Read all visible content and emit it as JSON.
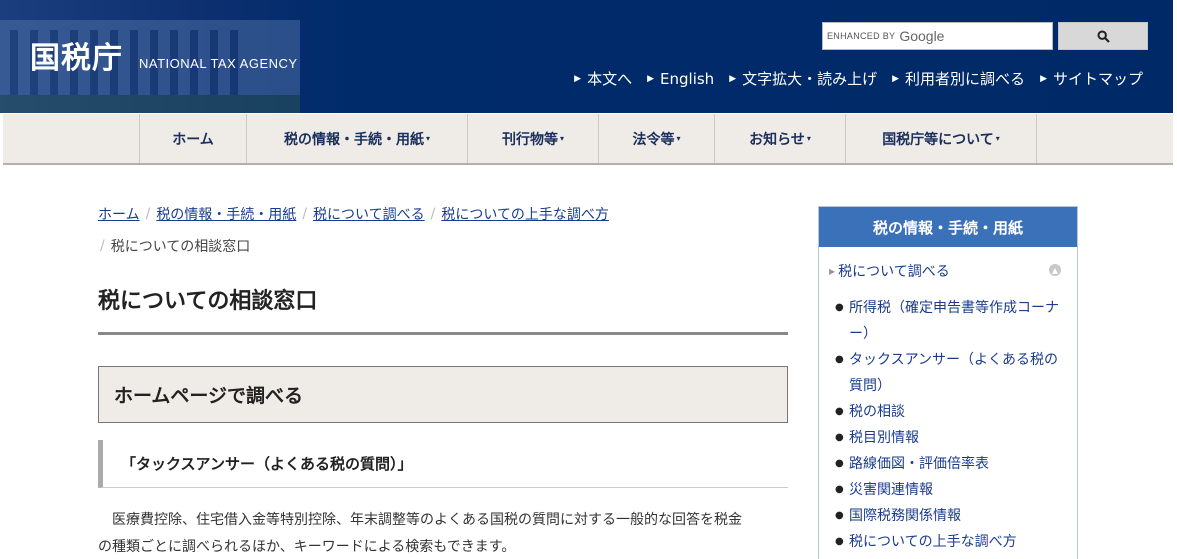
{
  "header": {
    "logo_kanji": "国税庁",
    "logo_en": "NATIONAL TAX AGENCY",
    "search": {
      "enhanced_label": "ENHANCED BY",
      "provider": "Google"
    },
    "util_links": [
      "本文へ",
      "English",
      "文字拡大・読み上げ",
      "利用者別に調べる",
      "サイトマップ"
    ]
  },
  "nav": {
    "items": [
      {
        "label": "ホーム",
        "dropdown": ""
      },
      {
        "label": "税の情報・手続・用紙",
        "dropdown": "▾"
      },
      {
        "label": "刊行物等",
        "dropdown": "▾"
      },
      {
        "label": "法令等",
        "dropdown": "▾"
      },
      {
        "label": "お知らせ",
        "dropdown": "▾"
      },
      {
        "label": "国税庁等について",
        "dropdown": "▾"
      }
    ]
  },
  "breadcrumb": {
    "items": [
      "ホーム",
      "税の情報・手続・用紙",
      "税について調べる",
      "税についての上手な調べ方"
    ],
    "current": "税についての相談窓口"
  },
  "main": {
    "title": "税についての相談窓口",
    "section_title": "ホームページで調べる",
    "sub_title": "「タックスアンサー（よくある税の質問）」",
    "body_line1": "医療費控除、住宅借入金等特別控除、年末調整等のよくある国税の質問に対する一般的な回答を税金",
    "body_line2": "の種類ごとに調べられるほか、キーワードによる検索もできます。"
  },
  "sidebar": {
    "heading": "税の情報・手続・用紙",
    "parent": "税について調べる",
    "items": [
      "所得税（確定申告書等作成コーナー）",
      "タックスアンサー（よくある税の質問）",
      "税の相談",
      "税目別情報",
      "路線価図・評価倍率表",
      "災害関連情報",
      "国際税務関係情報",
      "税についての上手な調べ方"
    ]
  },
  "colors": {
    "header_bg": "#002967",
    "nav_bg": "#efebe6",
    "link": "#1a3c8c",
    "sidebar_head": "#3a71b9"
  }
}
